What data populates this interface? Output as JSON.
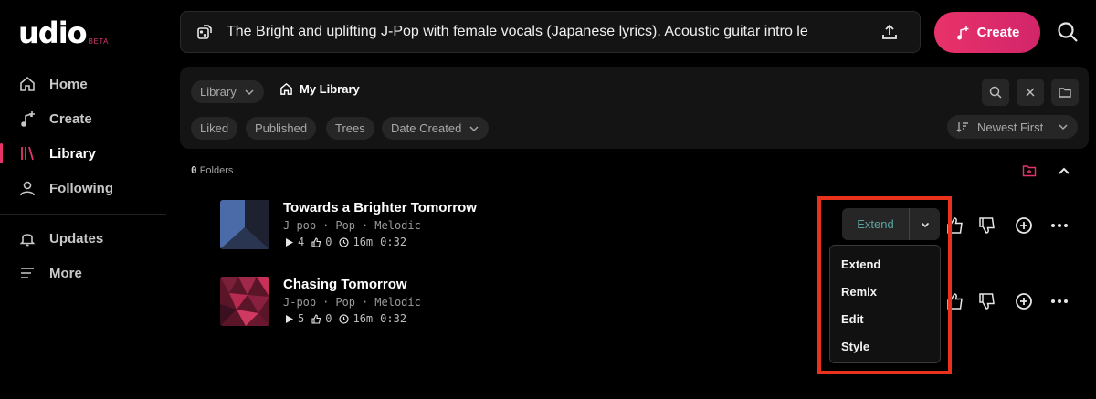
{
  "brand": {
    "name": "udio",
    "badge": "BETA",
    "accent": "#e8326a"
  },
  "sidebar": {
    "items": [
      {
        "label": "Home",
        "icon": "home-icon"
      },
      {
        "label": "Create",
        "icon": "create-music-icon"
      },
      {
        "label": "Library",
        "icon": "library-icon",
        "active": true
      },
      {
        "label": "Following",
        "icon": "user-icon"
      },
      {
        "label": "Updates",
        "icon": "bell-icon"
      },
      {
        "label": "More",
        "icon": "menu-icon"
      }
    ]
  },
  "prompt": {
    "value": "The Bright and uplifting J-Pop with female vocals (Japanese lyrics). Acoustic guitar intro le"
  },
  "create_button": {
    "label": "Create"
  },
  "library": {
    "breadcrumb": {
      "root": "Library",
      "current": "My Library"
    },
    "filters": [
      "Liked",
      "Published",
      "Trees",
      "Date Created"
    ],
    "sort": "Newest First",
    "folders_count": "0",
    "folders_label": "Folders"
  },
  "tracks": [
    {
      "title": "Towards a Brighter Tomorrow",
      "tags": [
        "J-pop",
        "Pop",
        "Melodic"
      ],
      "plays": "4",
      "likes": "0",
      "age": "16m",
      "duration": "0:32"
    },
    {
      "title": "Chasing Tomorrow",
      "tags": [
        "J-pop",
        "Pop",
        "Melodic"
      ],
      "plays": "5",
      "likes": "0",
      "age": "16m",
      "duration": "0:32"
    }
  ],
  "extend": {
    "button_label": "Extend",
    "menu": [
      "Extend",
      "Remix",
      "Edit",
      "Style"
    ]
  },
  "highlight_color": "#e8321c"
}
